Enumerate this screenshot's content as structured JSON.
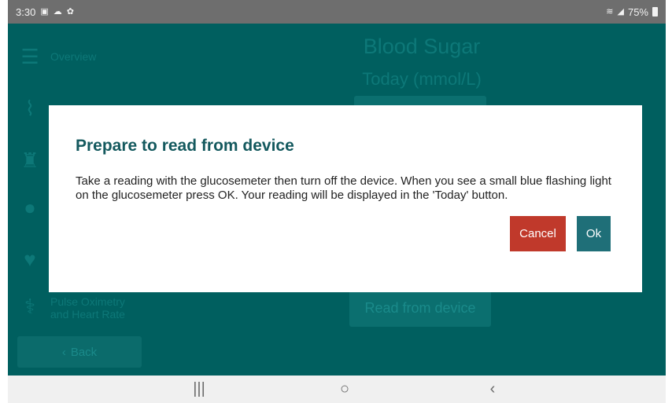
{
  "status_bar": {
    "time": "3:30",
    "battery": "75%",
    "icons": [
      "gallery-icon",
      "cloud-icon",
      "settings-icon",
      "wifi-icon",
      "signal-icon",
      "battery-icon"
    ]
  },
  "app": {
    "title": "Blood Sugar",
    "subtitle": "Today (mmol/L)",
    "read_button": "Read from device",
    "back_button": "Back",
    "sidebar": {
      "menu_label": "Overview",
      "pulse_label_line1": "Pulse Oximetry",
      "pulse_label_line2": "and Heart Rate"
    },
    "background_color": "#005f5f"
  },
  "dialog": {
    "title": "Prepare to read from device",
    "body": "Take a reading with the glucosemeter then turn off the device.  When you see a small blue flashing light on the glucosemeter press OK.  Your reading will be displayed in the 'Today' button.",
    "cancel_label": "Cancel",
    "ok_label": "Ok",
    "cancel_color": "#c0392b",
    "ok_color": "#1f6f78"
  },
  "nav_bar": {
    "recents_icon": "recents-icon",
    "home_icon": "home-icon",
    "back_icon": "back-icon"
  }
}
